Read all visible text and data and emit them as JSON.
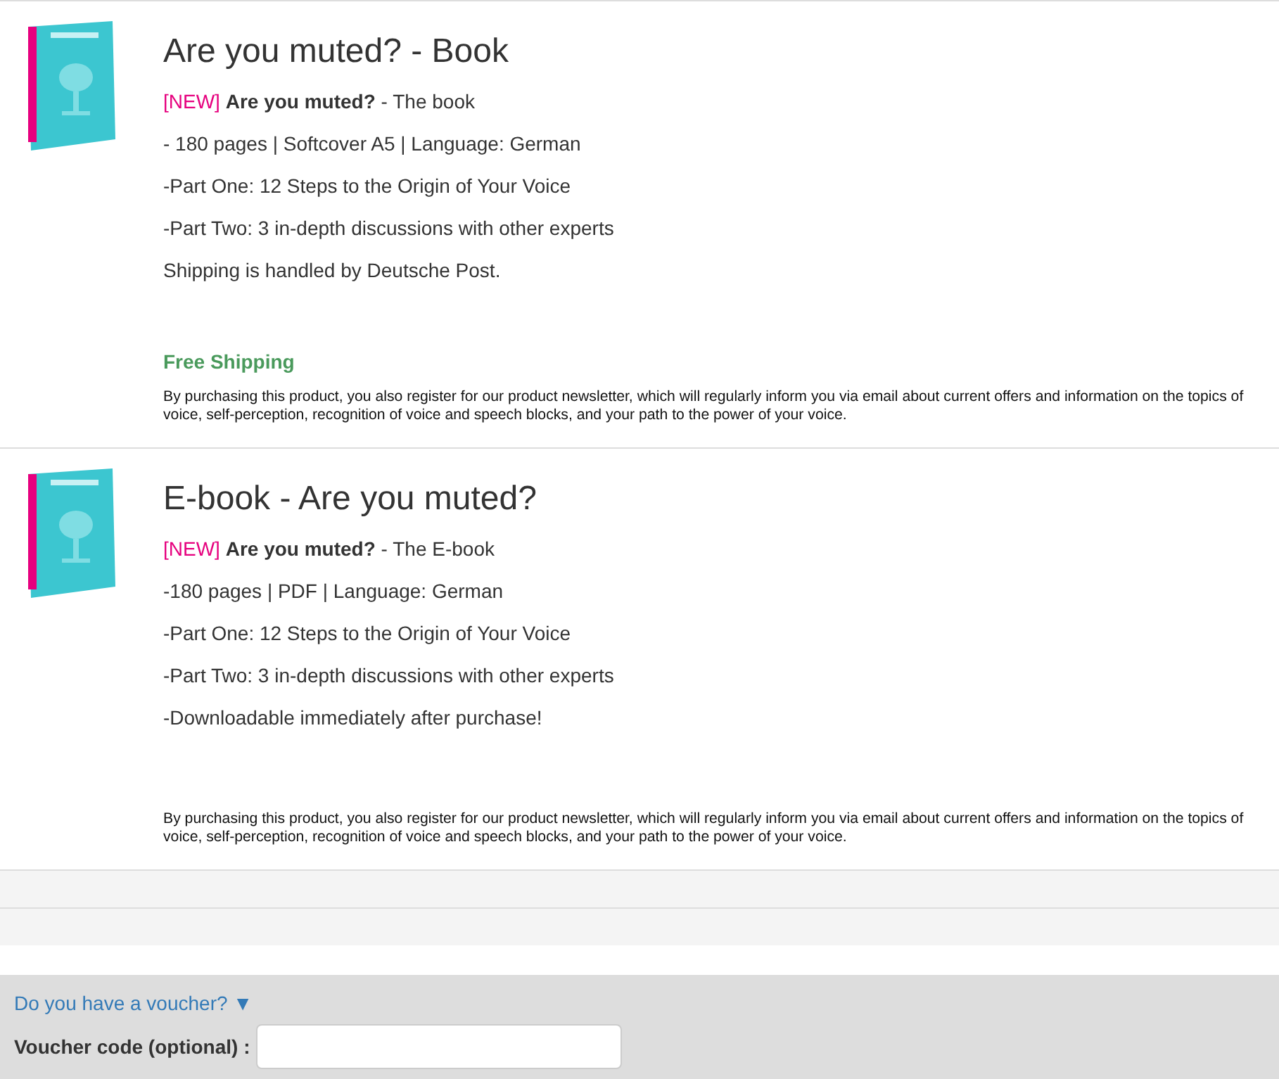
{
  "products": [
    {
      "title": "Are you muted? - Book",
      "tag": "[NEW]",
      "subtitle": "**Are you muted?** - The book",
      "features": [
        "- 180 pages | Softcover A5 | Language: German",
        "-Part One: 12 Steps to the Origin of Your Voice",
        "-Part Two: 3 in-depth discussions with other experts",
        "Shipping is handled by Deutsche Post."
      ],
      "shipping": "Free Shipping",
      "notice": "By purchasing this product, you also register for our product newsletter, which will regularly inform you via email about current offers and information on the topics of voice, self-perception, recognition of voice and speech blocks, and your path to the power of your voice."
    },
    {
      "title": "E-book - Are you muted?",
      "tag": "[NEW]",
      "subtitle": "**Are you muted?** - The E-book",
      "features": [
        "-180 pages | PDF | Language: German",
        "-Part One: 12 Steps to the Origin of Your Voice",
        "-Part Two: 3 in-depth discussions with other experts",
        "-Downloadable immediately after purchase!"
      ],
      "notice": "By purchasing this product, you also register for our product newsletter, which will regularly inform you via email about current offers and information on the topics of voice, self-perception, recognition of voice and speech blocks, and your path to the power of your voice."
    }
  ],
  "voucher": {
    "toggle": "Do you have a voucher? ▼",
    "label": "Voucher code (optional) :"
  }
}
